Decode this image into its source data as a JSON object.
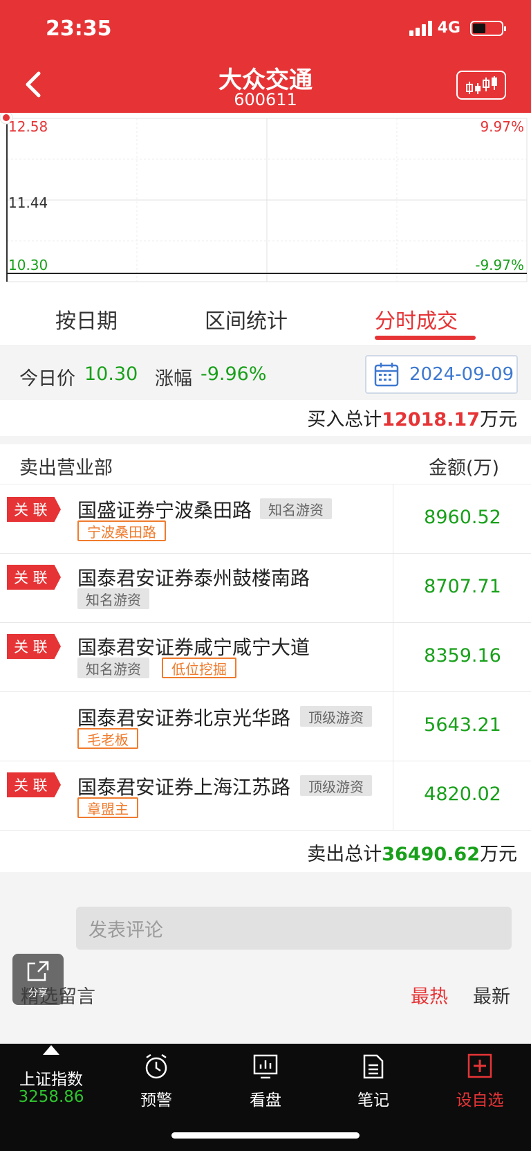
{
  "status": {
    "time": "23:35",
    "network": "4G"
  },
  "header": {
    "title": "大众交通",
    "code": "600611"
  },
  "chart": {
    "y_high": "12.58",
    "y_mid": "11.44",
    "y_low": "10.30",
    "pct_high": "9.97%",
    "pct_low": "-9.97%"
  },
  "tabs": [
    {
      "label": "按日期"
    },
    {
      "label": "区间统计"
    },
    {
      "label": "分时成交"
    }
  ],
  "price_bar": {
    "today_label": "今日价",
    "today_value": "10.30",
    "change_label": "涨幅",
    "change_value": "-9.96%",
    "date": "2024-09-09"
  },
  "buy_total": {
    "label": "买入总计",
    "value": "12018.17",
    "unit": "万元"
  },
  "sell": {
    "header_left": "卖出营业部",
    "header_right": "金额(万)",
    "rows": [
      {
        "flag": "关 联",
        "name": "国盛证券宁波桑田路",
        "tags": [
          "知名游资",
          "宁波桑田路"
        ],
        "amount": "8960.52"
      },
      {
        "flag": "关 联",
        "name": "国泰君安证券泰州鼓楼南路",
        "tags": [
          "知名游资"
        ],
        "amount": "8707.71"
      },
      {
        "flag": "关 联",
        "name": "国泰君安证券咸宁咸宁大道",
        "tags": [
          "知名游资",
          "低位挖掘"
        ],
        "amount": "8359.16"
      },
      {
        "flag": "",
        "name": "国泰君安证券北京光华路",
        "tags": [
          "顶级游资",
          "毛老板"
        ],
        "amount": "5643.21"
      },
      {
        "flag": "关 联",
        "name": "国泰君安证券上海江苏路",
        "tags": [
          "顶级游资",
          "章盟主"
        ],
        "amount": "4820.02"
      }
    ],
    "total_label": "卖出总计",
    "total_value": "36490.62",
    "total_unit": "万元"
  },
  "comments": {
    "placeholder": "发表评论",
    "title": "精选留言",
    "sort_hot": "最热",
    "sort_new": "最新",
    "share": "分享"
  },
  "bottom_nav": {
    "index_name": "上证指数",
    "index_value": "3258.86",
    "items": [
      {
        "label": "预警"
      },
      {
        "label": "看盘"
      },
      {
        "label": "笔记"
      },
      {
        "label": "设自选"
      }
    ]
  },
  "colors": {
    "brand_red": "#e63436",
    "down_green": "#18a01a",
    "tag_orange": "#ef7b2d",
    "date_blue": "#3d78d0"
  }
}
